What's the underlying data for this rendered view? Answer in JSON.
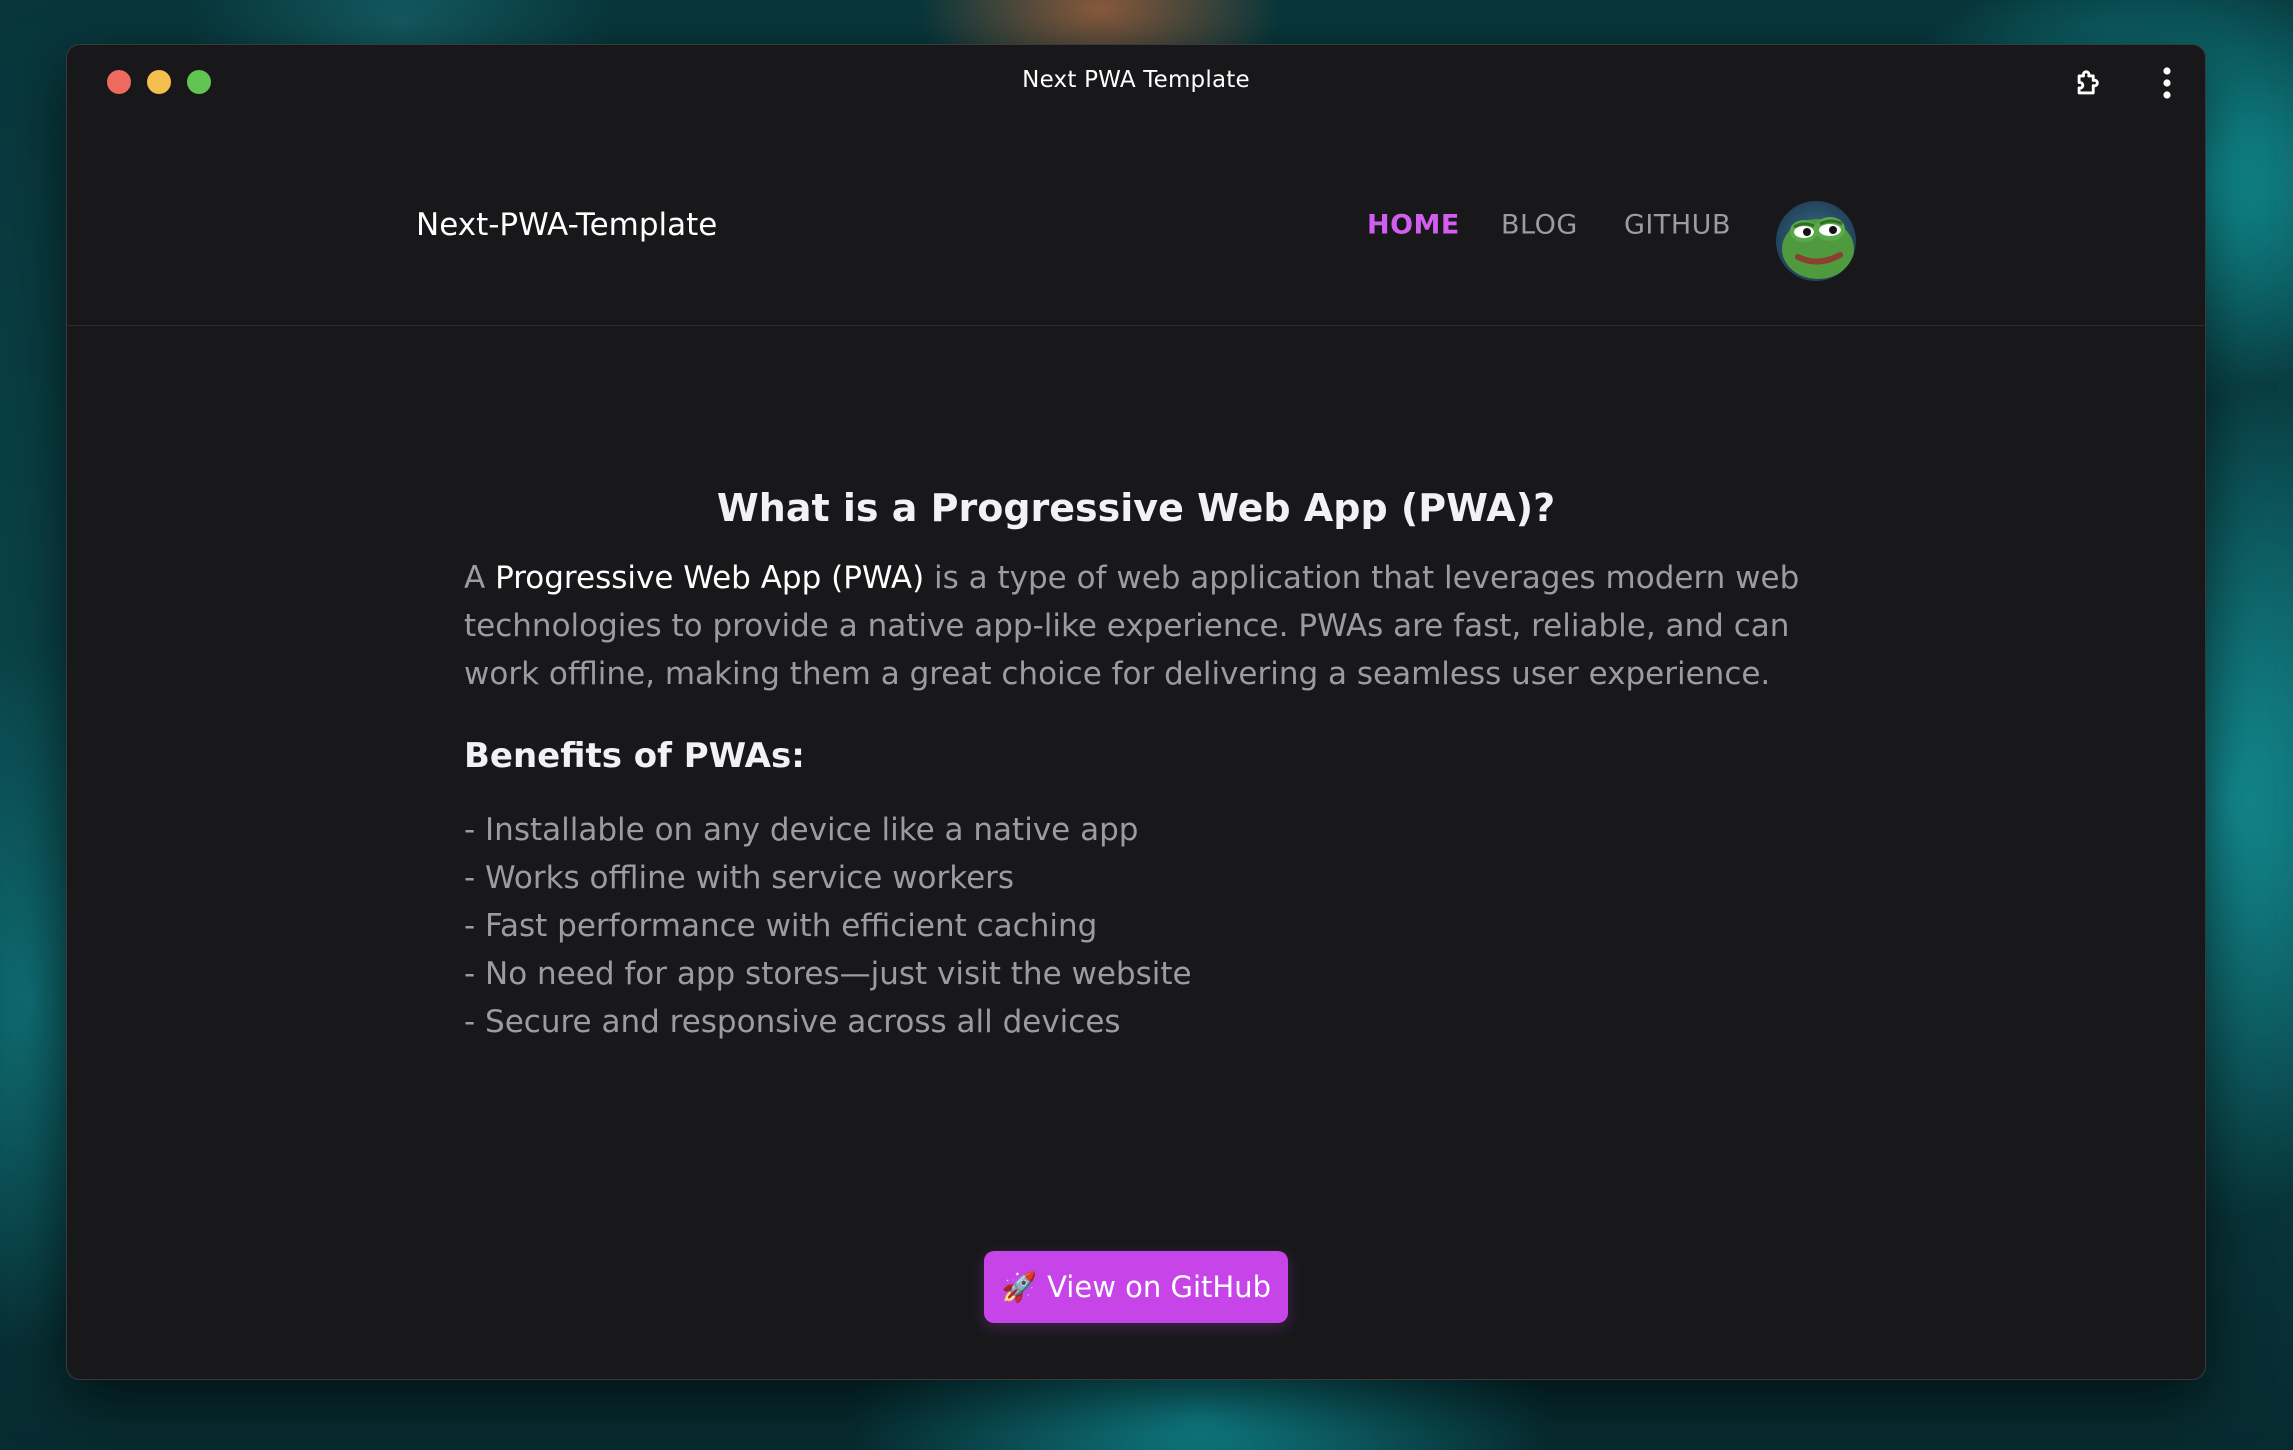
{
  "window": {
    "title": "Next PWA Template"
  },
  "header": {
    "brand": "Next-PWA-Template",
    "nav": [
      {
        "label": "HOME",
        "active": true
      },
      {
        "label": "BLOG",
        "active": false
      },
      {
        "label": "GITHUB",
        "active": false
      }
    ],
    "avatar_icon": "frog-avatar"
  },
  "main": {
    "title": "What is a Progressive Web App (PWA)?",
    "intro_prefix": "A",
    "intro_highlight": "Progressive Web App (PWA)",
    "intro_rest": "is a type of web application that leverages modern web technologies to provide a native app-like experience. PWAs are fast, reliable, and can work offline, making them a great choice for delivering a seamless user experience.",
    "benefits_title": "Benefits of PWAs:",
    "benefits": [
      "- Installable on any device like a native app",
      "- Works offline with service workers",
      "- Fast performance with efficient caching",
      "- No need for app stores—just visit the website",
      "- Secure and responsive across all devices"
    ],
    "cta_icon": "🚀",
    "cta_label": "View on GitHub"
  },
  "colors": {
    "accent": "#d15ef0",
    "button": "#c745e8",
    "background": "#18181b",
    "muted_text": "#9b9ba3"
  }
}
